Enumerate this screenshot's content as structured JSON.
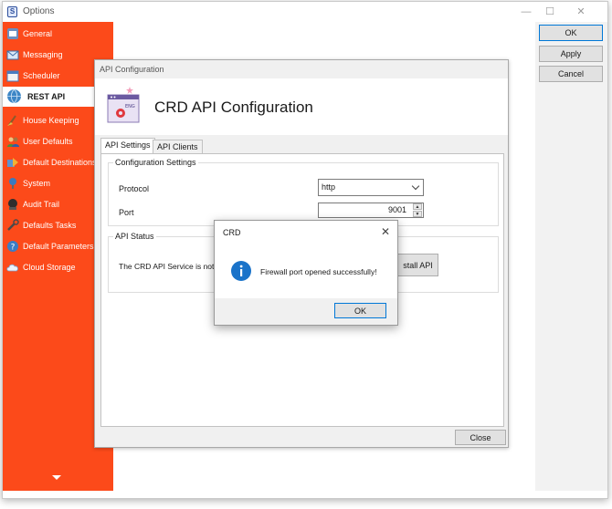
{
  "window": {
    "title": "Options",
    "app_icon": "crd-app-icon"
  },
  "sidebar": {
    "items": [
      {
        "label": "General",
        "icon": "general-icon"
      },
      {
        "label": "Messaging",
        "icon": "messaging-icon"
      },
      {
        "label": "Scheduler",
        "icon": "scheduler-icon"
      },
      {
        "label": "REST API",
        "icon": "globe-icon",
        "active": true
      },
      {
        "label": "House Keeping",
        "icon": "broom-icon"
      },
      {
        "label": "User Defaults",
        "icon": "users-icon"
      },
      {
        "label": "Default Destinations",
        "icon": "destinations-icon"
      },
      {
        "label": "System",
        "icon": "system-icon"
      },
      {
        "label": "Audit Trail",
        "icon": "audit-icon"
      },
      {
        "label": "Defaults Tasks",
        "icon": "wrench-icon"
      },
      {
        "label": "Default Parameters",
        "icon": "help-icon"
      },
      {
        "label": "Cloud Storage",
        "icon": "cloud-icon"
      }
    ]
  },
  "actions": {
    "ok": "OK",
    "apply": "Apply",
    "cancel": "Cancel"
  },
  "api_config": {
    "window_title": "API Configuration",
    "heading": "CRD API Configuration",
    "tabs": [
      "API Settings",
      "API Clients"
    ],
    "config_group": "Configuration Settings",
    "protocol_label": "Protocol",
    "protocol_value": "http",
    "port_label": "Port",
    "port_value": "9001",
    "status_group": "API Status",
    "status_text": "The CRD API Service is not ru",
    "install_button": "stall API",
    "close_button": "Close"
  },
  "dialog": {
    "title": "CRD",
    "message": "Firewall port opened successfully!",
    "ok_button": "OK"
  },
  "colors": {
    "sidebar": "#fc4a1a",
    "accent": "#0078d7",
    "info": "#1a73c9"
  }
}
